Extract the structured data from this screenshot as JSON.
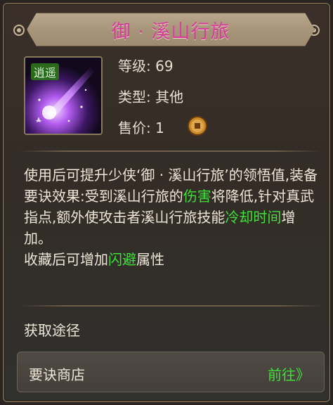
{
  "item": {
    "title": "御 · 溪山行旅",
    "icon_badge": "逍遥",
    "icon_name": "purple-comet-skill-icon",
    "level_label": "等级:",
    "level_value": "69",
    "type_label": "类型:",
    "type_value": "其他",
    "price_label": "售价:",
    "price_value": "1",
    "price_icon": "copper-coin-icon"
  },
  "description": {
    "p1_a": "使用后可提升少侠‘御 · 溪山行旅’的领悟值,装备要诀效果:受到溪山行旅的",
    "p1_green1": "伤害",
    "p1_b": "将降低,针对真武指点,额外使攻击者溪山行旅技能",
    "p1_green2": "冷却时间",
    "p1_c": "增加。",
    "p2_a": "收藏后可增加",
    "p2_green": "闪避",
    "p2_b": "属性"
  },
  "source": {
    "title": "获取途径",
    "shop_name": "要诀商店",
    "go_label": "前往》"
  },
  "colors": {
    "title": "#d83a9c",
    "highlight": "#3fe23a"
  }
}
